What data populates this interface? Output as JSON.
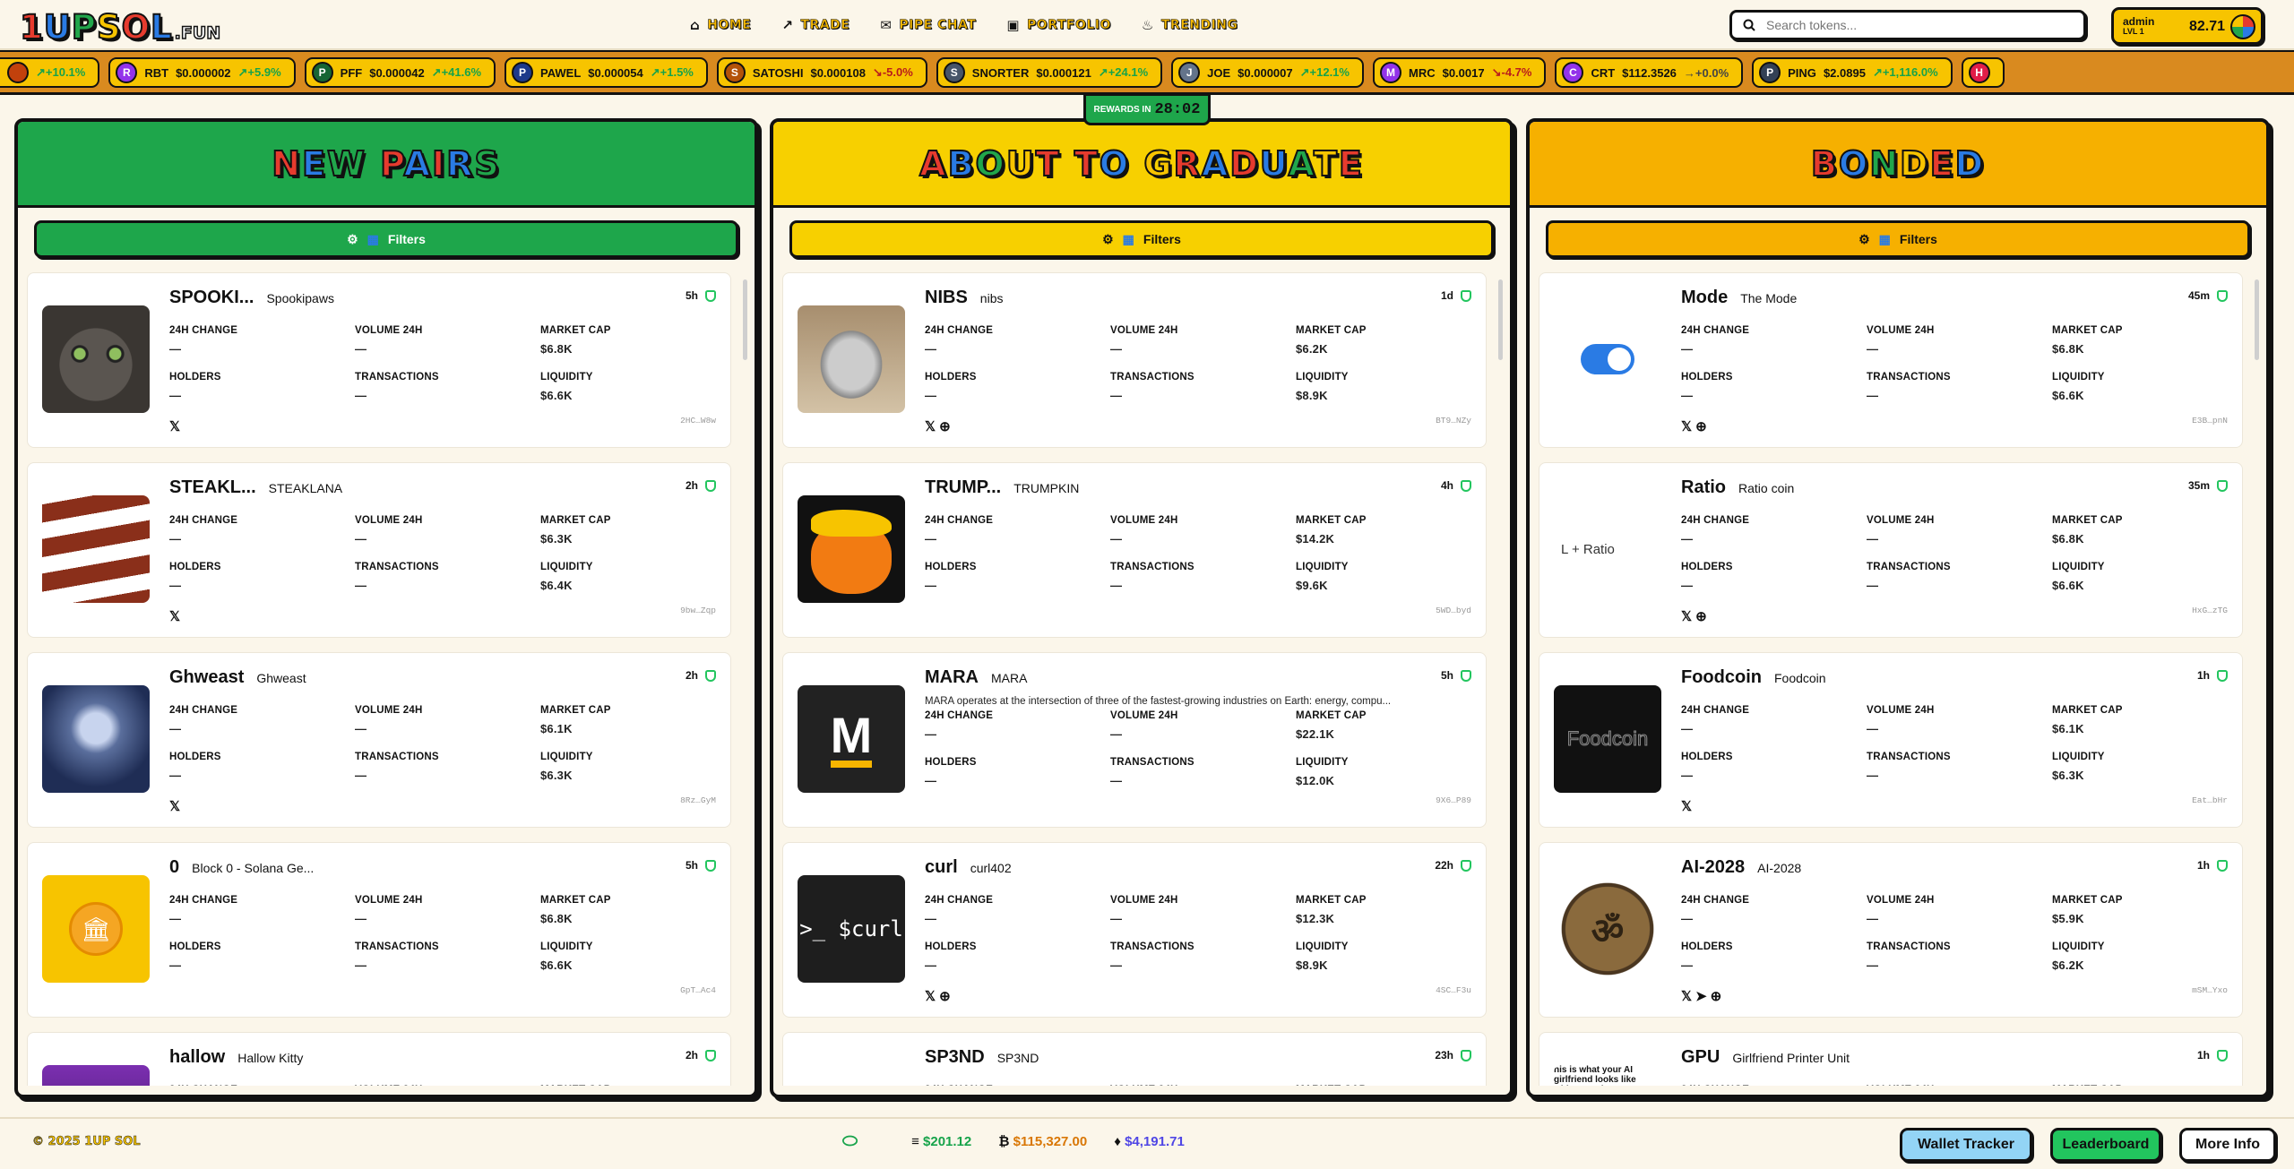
{
  "app": {
    "logo": "1UPSOL",
    "logo_suffix": ".FUN"
  },
  "nav": [
    {
      "label": "HOME",
      "icon": "⌂"
    },
    {
      "label": "TRADE",
      "icon": "↗"
    },
    {
      "label": "PIPE CHAT",
      "icon": "✉"
    },
    {
      "label": "PORTFOLIO",
      "icon": "▣"
    },
    {
      "label": "TRENDING",
      "icon": "♨"
    }
  ],
  "search": {
    "placeholder": "Search tokens..."
  },
  "user": {
    "name": "admin",
    "level": "LVL 1",
    "balance": "82.71"
  },
  "ticker": [
    {
      "sym": "",
      "price": "",
      "change": "↗+10.1%",
      "dir": "pos",
      "color": "#c2410c"
    },
    {
      "sym": "RBT",
      "price": "$0.000002",
      "change": "↗+5.9%",
      "dir": "pos",
      "color": "#9333ea",
      "ini": "R"
    },
    {
      "sym": "PFF",
      "price": "$0.000042",
      "change": "↗+41.6%",
      "dir": "pos",
      "color": "#166534",
      "ini": "P"
    },
    {
      "sym": "PAWEL",
      "price": "$0.000054",
      "change": "↗+1.5%",
      "dir": "pos",
      "color": "#1e3a8a",
      "ini": "P"
    },
    {
      "sym": "SATOSHI",
      "price": "$0.000108",
      "change": "↘-5.0%",
      "dir": "neg",
      "color": "#b45309",
      "ini": "S"
    },
    {
      "sym": "SNORTER",
      "price": "$0.000121",
      "change": "↗+24.1%",
      "dir": "pos",
      "color": "#475569",
      "ini": "S"
    },
    {
      "sym": "JOE",
      "price": "$0.000007",
      "change": "↗+12.1%",
      "dir": "pos",
      "color": "#64748b",
      "ini": "J"
    },
    {
      "sym": "MRC",
      "price": "$0.0017",
      "change": "↘-4.7%",
      "dir": "neg",
      "color": "#9333ea",
      "ini": "M"
    },
    {
      "sym": "CRT",
      "price": "$112.3526",
      "change": "→+0.0%",
      "dir": "neu",
      "color": "#9333ea",
      "ini": "C"
    },
    {
      "sym": "PING",
      "price": "$2.0895",
      "change": "↗+1,116.0%",
      "dir": "pos",
      "color": "#334155",
      "ini": "P"
    },
    {
      "sym": "",
      "price": "",
      "change": "",
      "dir": "neu",
      "color": "#e11d48",
      "ini": "H"
    }
  ],
  "rewards": {
    "label": "REWARDS IN",
    "time": "28:02"
  },
  "labels": {
    "change": "24H CHANGE",
    "volume": "VOLUME 24H",
    "mcap": "MARKET CAP",
    "holders": "HOLDERS",
    "tx": "TRANSACTIONS",
    "liq": "LIQUIDITY",
    "dash": "—",
    "filters": "Filters"
  },
  "columns": [
    {
      "title": "NEW PAIRS",
      "head": "#1ea64b",
      "btn": "#1ea64b",
      "btn_text": "#fff",
      "tokens": [
        {
          "sym": "SPOOKI...",
          "name": "Spookipaws",
          "age": "5h",
          "mcap": "$6.8K",
          "liq": "$6.6K",
          "addr": "2HC…W8w",
          "social": [
            "𝕏"
          ],
          "thumb": "cat"
        },
        {
          "sym": "STEAKL...",
          "name": "STEAKLANA",
          "age": "2h",
          "mcap": "$6.3K",
          "liq": "$6.4K",
          "addr": "9bw…Zqp",
          "social": [
            "𝕏"
          ],
          "thumb": "steak"
        },
        {
          "sym": "Ghweast",
          "name": "Ghweast",
          "age": "2h",
          "mcap": "$6.1K",
          "liq": "$6.3K",
          "addr": "8Rz…GyM",
          "social": [
            "𝕏"
          ],
          "thumb": "ghost"
        },
        {
          "sym": "0",
          "name": "Block 0 - Solana Ge...",
          "age": "5h",
          "mcap": "$6.8K",
          "liq": "$6.6K",
          "addr": "GpT…Ac4",
          "social": [],
          "thumb": "coin"
        },
        {
          "sym": "hallow",
          "name": "Hallow Kitty",
          "age": "2h",
          "mcap": "",
          "liq": "",
          "addr": "",
          "social": [],
          "thumb": "purple"
        }
      ]
    },
    {
      "title": "ABOUT TO GRADUATE",
      "head": "#f7d000",
      "btn": "#f7d000",
      "btn_text": "#111",
      "tokens": [
        {
          "sym": "NIBS",
          "name": "nibs",
          "age": "1d",
          "mcap": "$6.2K",
          "liq": "$8.9K",
          "addr": "BT9…NZy",
          "social": [
            "𝕏",
            "⊕"
          ],
          "thumb": "raccoon"
        },
        {
          "sym": "TRUMP...",
          "name": "TRUMPKIN",
          "age": "4h",
          "mcap": "$14.2K",
          "liq": "$9.6K",
          "addr": "5WD…byd",
          "social": [],
          "thumb": "pumpkin"
        },
        {
          "sym": "MARA",
          "name": "MARA",
          "age": "5h",
          "mcap": "$22.1K",
          "liq": "$12.0K",
          "addr": "9X6…P89",
          "social": [],
          "thumb": "mara",
          "desc": "MARA operates at the intersection of three of the fastest-growing industries on Earth: energy, compu..."
        },
        {
          "sym": "curl",
          "name": "curl402",
          "age": "22h",
          "mcap": "$12.3K",
          "liq": "$8.9K",
          "addr": "4SC…F3u",
          "social": [
            "𝕏",
            "⊕"
          ],
          "thumb": "curl"
        },
        {
          "sym": "SP3ND",
          "name": "SP3ND",
          "age": "23h",
          "mcap": "",
          "liq": "",
          "addr": "",
          "social": [],
          "thumb": "teal"
        }
      ]
    },
    {
      "title": "BONDED",
      "head": "#f6b000",
      "btn": "#f6b000",
      "btn_text": "#111",
      "tokens": [
        {
          "sym": "Mode",
          "name": "The Mode",
          "age": "45m",
          "mcap": "$6.8K",
          "liq": "$6.6K",
          "addr": "E3B…pnN",
          "social": [
            "𝕏",
            "⊕"
          ],
          "thumb": "toggle"
        },
        {
          "sym": "Ratio",
          "name": "Ratio coin",
          "age": "35m",
          "mcap": "$6.8K",
          "liq": "$6.6K",
          "addr": "HxG…zTG",
          "social": [
            "𝕏",
            "⊕"
          ],
          "thumb": "ratio"
        },
        {
          "sym": "Foodcoin",
          "name": "Foodcoin",
          "age": "1h",
          "mcap": "$6.1K",
          "liq": "$6.3K",
          "addr": "Eat…bHr",
          "social": [
            "𝕏"
          ],
          "thumb": "food"
        },
        {
          "sym": "AI-2028",
          "name": "AI-2028",
          "age": "1h",
          "mcap": "$5.9K",
          "liq": "$6.2K",
          "addr": "mSM…Yxo",
          "social": [
            "𝕏",
            "➤",
            "⊕"
          ],
          "thumb": "bronze"
        },
        {
          "sym": "GPU",
          "name": "Girlfriend Printer Unit",
          "age": "1h",
          "mcap": "",
          "liq": "",
          "addr": "",
          "social": [],
          "thumb": "gpu"
        }
      ]
    }
  ],
  "thumbs": {
    "ratio": "L + Ratio",
    "food": "Foodcoin",
    "curl": ">_ $curl",
    "mara": "M",
    "gpu": "his is what your AI girlfriend looks like without makeup"
  },
  "footer": {
    "brand": "© 2025 1UP SOL",
    "sol": "$201.12",
    "btc": "$115,327.00",
    "eth": "$4,191.71",
    "btn1": "Wallet Tracker",
    "btn2": "Leaderboard",
    "btn3": "More Info"
  }
}
